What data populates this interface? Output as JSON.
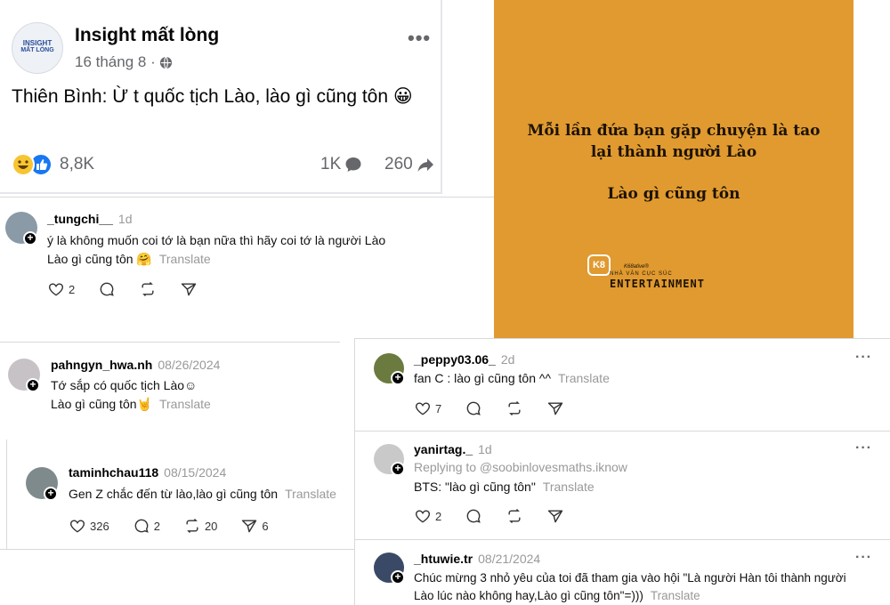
{
  "fb_post": {
    "page_name": "Insight mất lòng",
    "logo_text_line1": "INSIGHT",
    "logo_text_line2": "MẤT LÒNG",
    "date": "16 tháng 8 ·",
    "text": "Thiên Bình: Ừ t quốc tịch Lào, lào gì cũng tôn 😀",
    "reactions_count": "8,8K",
    "comments_count": "1K",
    "shares_count": "260"
  },
  "image_card": {
    "line1": "Mỗi lần đứa bạn gặp chuyện là tao",
    "line2": "lại thành người Lào",
    "line3": "Lào gì cũng tôn",
    "logo_mark": "K8",
    "brand_small": "K68ative®",
    "brand_sub": "NHÀ VĂN CỤC SÚC",
    "brand_main": "ENTERTAINMENT"
  },
  "translate_label": "Translate",
  "comments": [
    {
      "username": "_tungchi__",
      "time": "1d",
      "line1": "ý là không muốn coi tớ là bạn nữa thì hãy coi tớ là người Lào",
      "line2": "Lào gì cũng tôn 🤗",
      "likes": "2"
    },
    {
      "username": "pahngyn_hwa.nh",
      "time": "08/26/2024",
      "line1": "Tớ sắp có quốc tịch Lào☺",
      "line2": "Lào gì cũng tôn🤘"
    },
    {
      "username": "taminhchau118",
      "time": "08/15/2024",
      "line1": "Gen Z chắc đến từ lào,lào gì cũng tôn",
      "likes": "326",
      "replies": "2",
      "reposts": "20",
      "shares": "6"
    },
    {
      "username": "_peppy03.06_",
      "time": "2d",
      "line1": "fan C : lào gì cũng tôn ^^",
      "likes": "7"
    },
    {
      "username": "yanirtag._",
      "time": "1d",
      "reply_to": "Replying to @soobinlovesmaths.iknow",
      "line1": "BTS: \"lào gì cũng tôn\"",
      "likes": "2"
    },
    {
      "username": "_htuwie.tr",
      "time": "08/21/2024",
      "line1": "Chúc mừng 3 nhỏ yêu của toi đã tham gia vào hội \"Là người Hàn tôi thành người",
      "line2": "Lào lúc nào không hay,Lào gì cũng tôn\"=)))"
    }
  ],
  "colors": {
    "card_orange": "#e09a30",
    "text_gray": "#999999",
    "fb_blue": "#1877f2",
    "fb_yellow": "#f7c531"
  }
}
